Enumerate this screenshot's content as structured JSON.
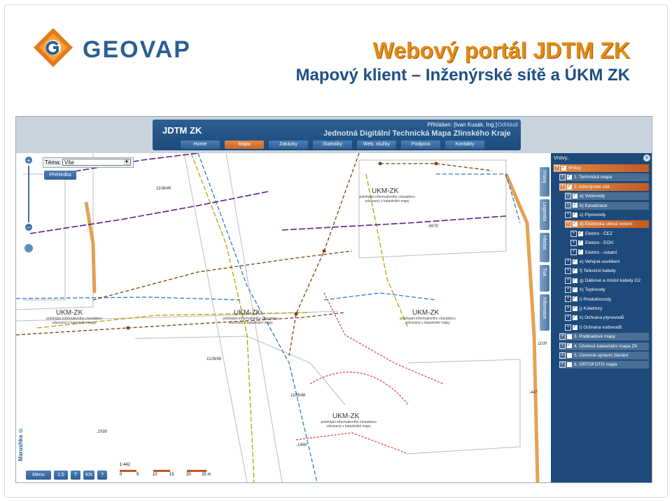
{
  "slide": {
    "logo_text": "GEOVAP",
    "title": "Webový portál JDTM ZK",
    "subtitle": "Mapový klient – Inženýrské sítě a ÚKM ZK"
  },
  "app": {
    "banner_title": "JDTM ZK",
    "banner_subtitle": "Jednotná Digitální Technická Mapa Zlínského Kraje",
    "login_text": "Přihlášen: [Ivan Kusák, Ing.]",
    "logout": "Odhlásit",
    "nav": [
      "Home",
      "Mapa",
      "Zakázky",
      "Statistiky",
      "Web. služby",
      "Podpora",
      "Kontakty"
    ],
    "nav_active_index": 1,
    "theme_label": "Téma:",
    "theme_value": "Vše",
    "overview_button": "Přehledka",
    "side_tabs": [
      "Vrstvy",
      "Legenda",
      "Hledat",
      "Tisk",
      "Informace"
    ],
    "bottom_tools": [
      "Menu",
      "1:5 <",
      "T",
      "KN",
      "?"
    ],
    "scale_ratio": "1:442",
    "scale_ticks": [
      "0",
      "5",
      "10",
      "15",
      "20",
      "25 m"
    ],
    "brand_vertical": "Marushka ©"
  },
  "map": {
    "parcels": [
      "1108/46",
      ".6670",
      "1109/96",
      "1109/48",
      ".2590",
      ".1468",
      ".447",
      "1109"
    ],
    "ukm_label": "UKM-ZK",
    "ukm_sub_1": "polohopis informativního charakteru",
    "ukm_sub_2": "odvozený z katastrální mapy",
    "colors": {
      "gas": "#b5a300",
      "water": "#2e7ac9",
      "sewer": "#7a3f10",
      "electric": "#5a1f8c",
      "parcel": "#e23a3a",
      "district": "#e08a28"
    }
  },
  "layers": {
    "title": "Vrstvy..",
    "items": [
      {
        "label": "Vrstvy",
        "checked": true,
        "type": "hl"
      },
      {
        "label": "1. Technická mapa",
        "checked": true,
        "type": "grp"
      },
      {
        "label": "2. Inženýrské sítě",
        "checked": true,
        "type": "hl"
      },
      {
        "label": "a) Vodovody",
        "checked": true,
        "type": "grp"
      },
      {
        "label": "b) Kanalizace",
        "checked": true,
        "type": "grp"
      },
      {
        "label": "c) Plynovody",
        "checked": true,
        "type": "plain"
      },
      {
        "label": "d) Elektrická silová vedení",
        "checked": true,
        "type": "hl"
      },
      {
        "label": "Elektro - ČEZ",
        "checked": true,
        "type": "plain"
      },
      {
        "label": "Elektro - EON",
        "checked": true,
        "type": "plain"
      },
      {
        "label": "Elektro - ostatní",
        "checked": true,
        "type": "plain"
      },
      {
        "label": "e) Veřejné osvětlení",
        "checked": true,
        "type": "plain"
      },
      {
        "label": "f) Televizní kabely",
        "checked": true,
        "type": "plain"
      },
      {
        "label": "g) Dálkové a místní kabely O2",
        "checked": true,
        "type": "plain"
      },
      {
        "label": "h) Teplovody",
        "checked": true,
        "type": "plain"
      },
      {
        "label": "i) Produktovody",
        "checked": true,
        "type": "plain"
      },
      {
        "label": "j) Kolektory",
        "checked": true,
        "type": "plain"
      },
      {
        "label": "k) Ochrana plynovodů",
        "checked": true,
        "type": "plain"
      },
      {
        "label": "l) Ochrana vodovodů",
        "checked": true,
        "type": "plain"
      },
      {
        "label": "3. Podkladové mapy",
        "checked": false,
        "type": "grp"
      },
      {
        "label": "4. Účelová katastrální mapa ZK",
        "checked": true,
        "type": "grp"
      },
      {
        "label": "5. Územně-správní členění",
        "checked": false,
        "type": "grp"
      },
      {
        "label": "6. ORTOFOTO mapa",
        "checked": false,
        "type": "grp"
      }
    ]
  }
}
